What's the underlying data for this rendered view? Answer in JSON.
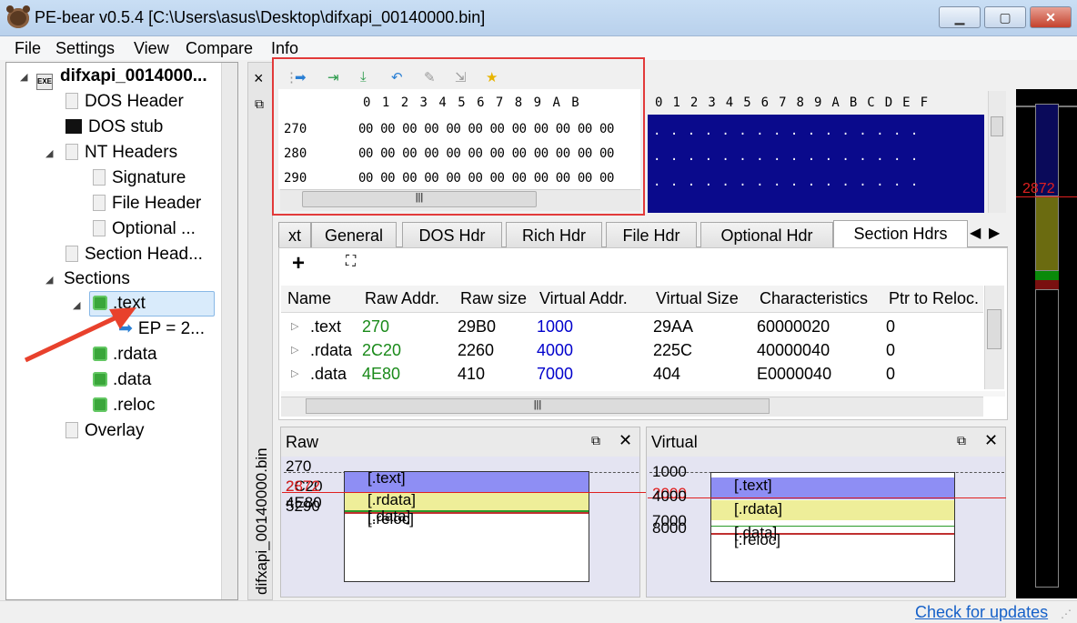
{
  "window": {
    "title": "PE-bear v0.5.4 [C:\\Users\\asus\\Desktop\\difxapi_00140000.bin]"
  },
  "menu": [
    "File",
    "Settings",
    "View",
    "Compare",
    "Info"
  ],
  "tree": {
    "root": "difxapi_0014000...",
    "dos_header": "DOS Header",
    "dos_stub": "DOS stub",
    "nt_headers": "NT Headers",
    "signature": "Signature",
    "file_header": "File Header",
    "optional": "Optional ...",
    "section_headers": "Section Head...",
    "sections": "Sections",
    "text": ".text",
    "ep": "EP = 2...",
    "rdata": ".rdata",
    "data": ".data",
    "reloc": ".reloc",
    "overlay": "Overlay"
  },
  "dock": {
    "vertical_label": "difxapi_00140000.bin",
    "close_glyph": "×",
    "float_glyph": "⧉"
  },
  "hex": {
    "columns": [
      "0",
      "1",
      "2",
      "3",
      "4",
      "5",
      "6",
      "7",
      "8",
      "9",
      "A",
      "B"
    ],
    "ascii_columns": [
      "0",
      "1",
      "2",
      "3",
      "4",
      "5",
      "6",
      "7",
      "8",
      "9",
      "A",
      "B",
      "C",
      "D",
      "E",
      "F"
    ],
    "rows": [
      {
        "addr": "270",
        "bytes": "00 00 00 00 00 00 00 00 00 00 00 00"
      },
      {
        "addr": "280",
        "bytes": "00 00 00 00 00 00 00 00 00 00 00 00"
      },
      {
        "addr": "290",
        "bytes": "00 00 00 00 00 00 00 00 00 00 00 00"
      }
    ],
    "ascii_rows": [
      ". . . . . . . . . . . . . . . .",
      ". . . . . . . . . . . . . . . .",
      ". . . . . . . . . . . . . . . ."
    ]
  },
  "strip": {
    "marker": "2872"
  },
  "tabs": [
    "xt",
    "General",
    "DOS Hdr",
    "Rich Hdr",
    "File Hdr",
    "Optional Hdr",
    "Section Hdrs"
  ],
  "section_table": {
    "headers": [
      "Name",
      "Raw Addr.",
      "Raw size",
      "Virtual Addr.",
      "Virtual Size",
      "Characteristics",
      "Ptr to Reloc."
    ],
    "rows": [
      {
        "name": ".text",
        "raw_addr": "270",
        "raw_size": "29B0",
        "virt_addr": "1000",
        "virt_size": "29AA",
        "chars": "60000020",
        "ptr": "0"
      },
      {
        "name": ".rdata",
        "raw_addr": "2C20",
        "raw_size": "2260",
        "virt_addr": "4000",
        "virt_size": "225C",
        "chars": "40000040",
        "ptr": "0"
      },
      {
        "name": ".data",
        "raw_addr": "4E80",
        "raw_size": "410",
        "virt_addr": "7000",
        "virt_size": "404",
        "chars": "E0000040",
        "ptr": "0"
      }
    ],
    "add_glyph": "+",
    "fit_glyph": "⛶"
  },
  "raw_map": {
    "title": "Raw",
    "addrs": [
      "270",
      "2C20",
      "2872",
      "4E80",
      "5290"
    ],
    "labels": [
      "[.text]",
      "[.rdata]",
      "[.data]",
      "[.reloc]"
    ]
  },
  "virtual_map": {
    "title": "Virtual",
    "addrs": [
      "1000",
      "2000",
      "4000",
      "7000",
      "8000"
    ],
    "labels": [
      "[.text]",
      "[.rdata]",
      "[.data]",
      "[.reloc]"
    ]
  },
  "status": {
    "updates": "Check for updates"
  },
  "colors": {
    "text_section": "#8e8ef4",
    "rdata_section": "#eeee99",
    "hex_ascii_bg": "#0a0a8c",
    "highlight": "#e23a3a"
  }
}
